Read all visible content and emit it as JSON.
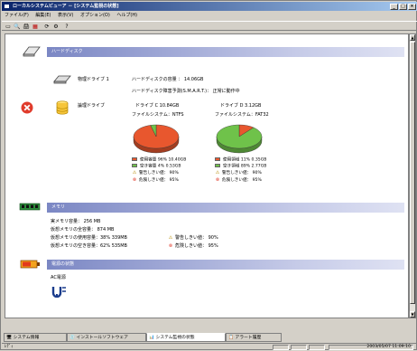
{
  "window": {
    "title": "ローカルシステムビューア － [システム監視の状態]",
    "min_label": "_",
    "max_label": "□",
    "close_label": "×"
  },
  "menu": [
    "ファイル(F)",
    "編集(E)",
    "表示(V)",
    "オプション(O)",
    "ヘルプ(H)"
  ],
  "toolbar_icons": [
    "new-icon",
    "preview-icon",
    "print-icon",
    "export-icon",
    "refresh-icon",
    "settings-icon",
    "help-icon"
  ],
  "toolbar_glyphs": [
    "▭",
    "🔍",
    "🖨",
    "▦",
    "⟳",
    "⚙",
    "?"
  ],
  "harddisk": {
    "heading": "ハードディスク",
    "physical_label": "物理ドライブ 1",
    "capacity_line": "ハードディスクの容量 ： 14.06GB",
    "prediction_line": "ハードディスク障害予測(S.M.A.R.T.)： 正常に動作中",
    "logical_label": "論理ドライブ",
    "drives": [
      {
        "title": "ドライブ C 10.84GB",
        "fs": "ファイルシステム：NTFS",
        "used_fraction": 0.96,
        "used_color": "#e8572e",
        "free_color": "#6fc24a",
        "legend": [
          "使用容量 96% 10.40GB",
          "空き容量 4% 0.53GB",
          "警告しきい値：  90%",
          "危険しきい値：  95%"
        ]
      },
      {
        "title": "ドライブ D 3.12GB",
        "fs": "ファイルシステム：FAT32",
        "used_fraction": 0.11,
        "used_color": "#e8572e",
        "free_color": "#6fc24a",
        "legend": [
          "使用領域 11% 0.35GB",
          "空き領域 89% 2.77GB",
          "警告しきい値：  90%",
          "危険しきい値：  95%"
        ]
      }
    ]
  },
  "memory": {
    "heading": "メモリ",
    "lines": [
      "実メモリ容量： 256 MB",
      "仮想メモリの全容量： 874 MB",
      "仮想メモリの使用容量：38% 339MB",
      "仮想メモリの空き容量：62% 535MB"
    ],
    "warn": "警告しきい値：  90%",
    "danger": "危険しきい値：  95%"
  },
  "power": {
    "heading": "電源の状態",
    "line": "AC電源"
  },
  "tabs": [
    "システム情報",
    "インストールソフトウェア",
    "システム監視の状態",
    "アラート履歴"
  ],
  "status": {
    "left": "ﾚﾃﾞｨ",
    "datetime": "2003/05/07 11:09:10"
  }
}
